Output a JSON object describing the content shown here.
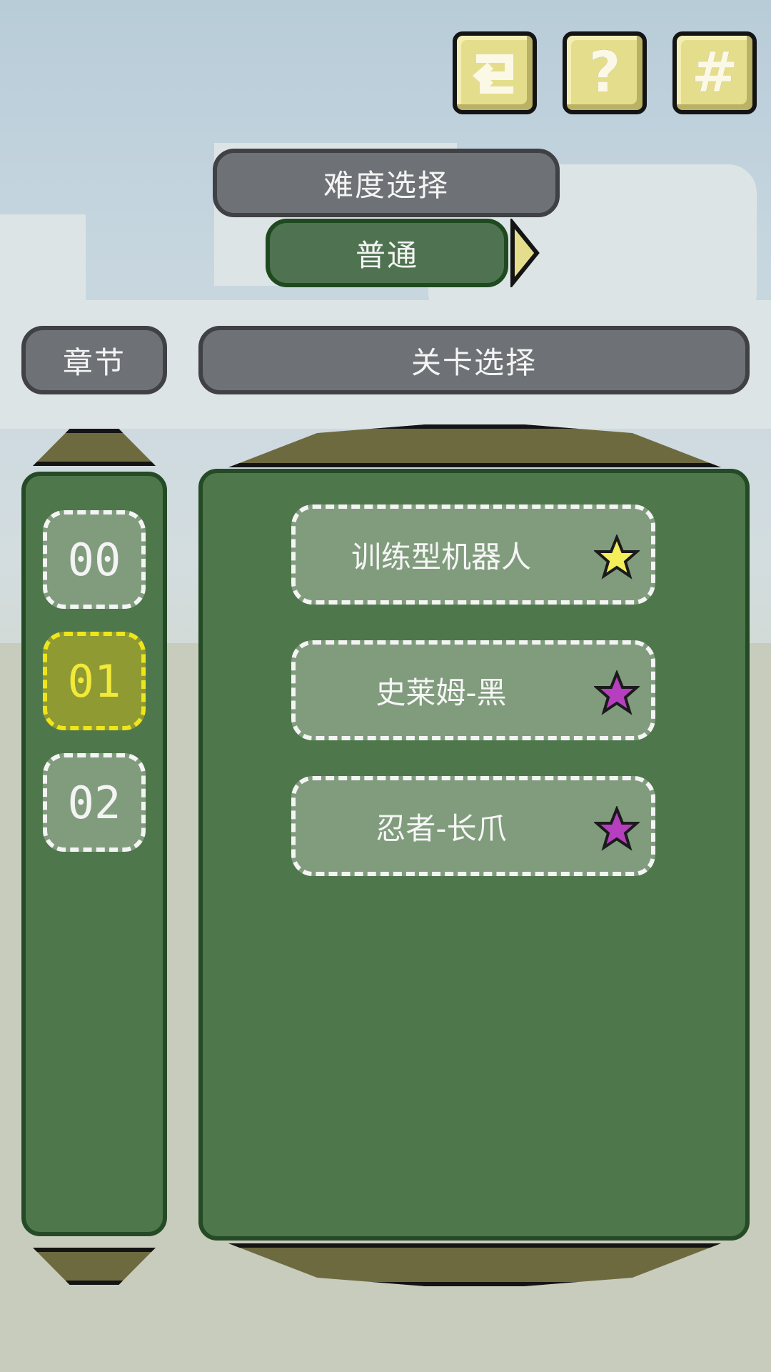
{
  "toolbar": {
    "undo_icon": "return-arrow-icon",
    "help_glyph": "?",
    "settings_glyph": "#"
  },
  "difficulty": {
    "title": "难度选择",
    "current": "普通"
  },
  "chapters": {
    "title": "章节",
    "items": [
      {
        "label": "00",
        "selected": false
      },
      {
        "label": "01",
        "selected": true
      },
      {
        "label": "02",
        "selected": false
      }
    ]
  },
  "levels": {
    "title": "关卡选择",
    "items": [
      {
        "label": "训练型机器人",
        "star": "yellow-star-icon",
        "star_color": "#f4ee5a"
      },
      {
        "label": "史莱姆-黑",
        "star": "purple-star-icon",
        "star_color": "#b63fc0"
      },
      {
        "label": "忍者-长爪",
        "star": "purple-star-icon",
        "star_color": "#b63fc0"
      }
    ]
  },
  "colors": {
    "panel_green": "#4f774c",
    "pill_gray": "#6e7175",
    "button_yellow": "#e4de8c",
    "selected_yellow": "#efe51a"
  }
}
